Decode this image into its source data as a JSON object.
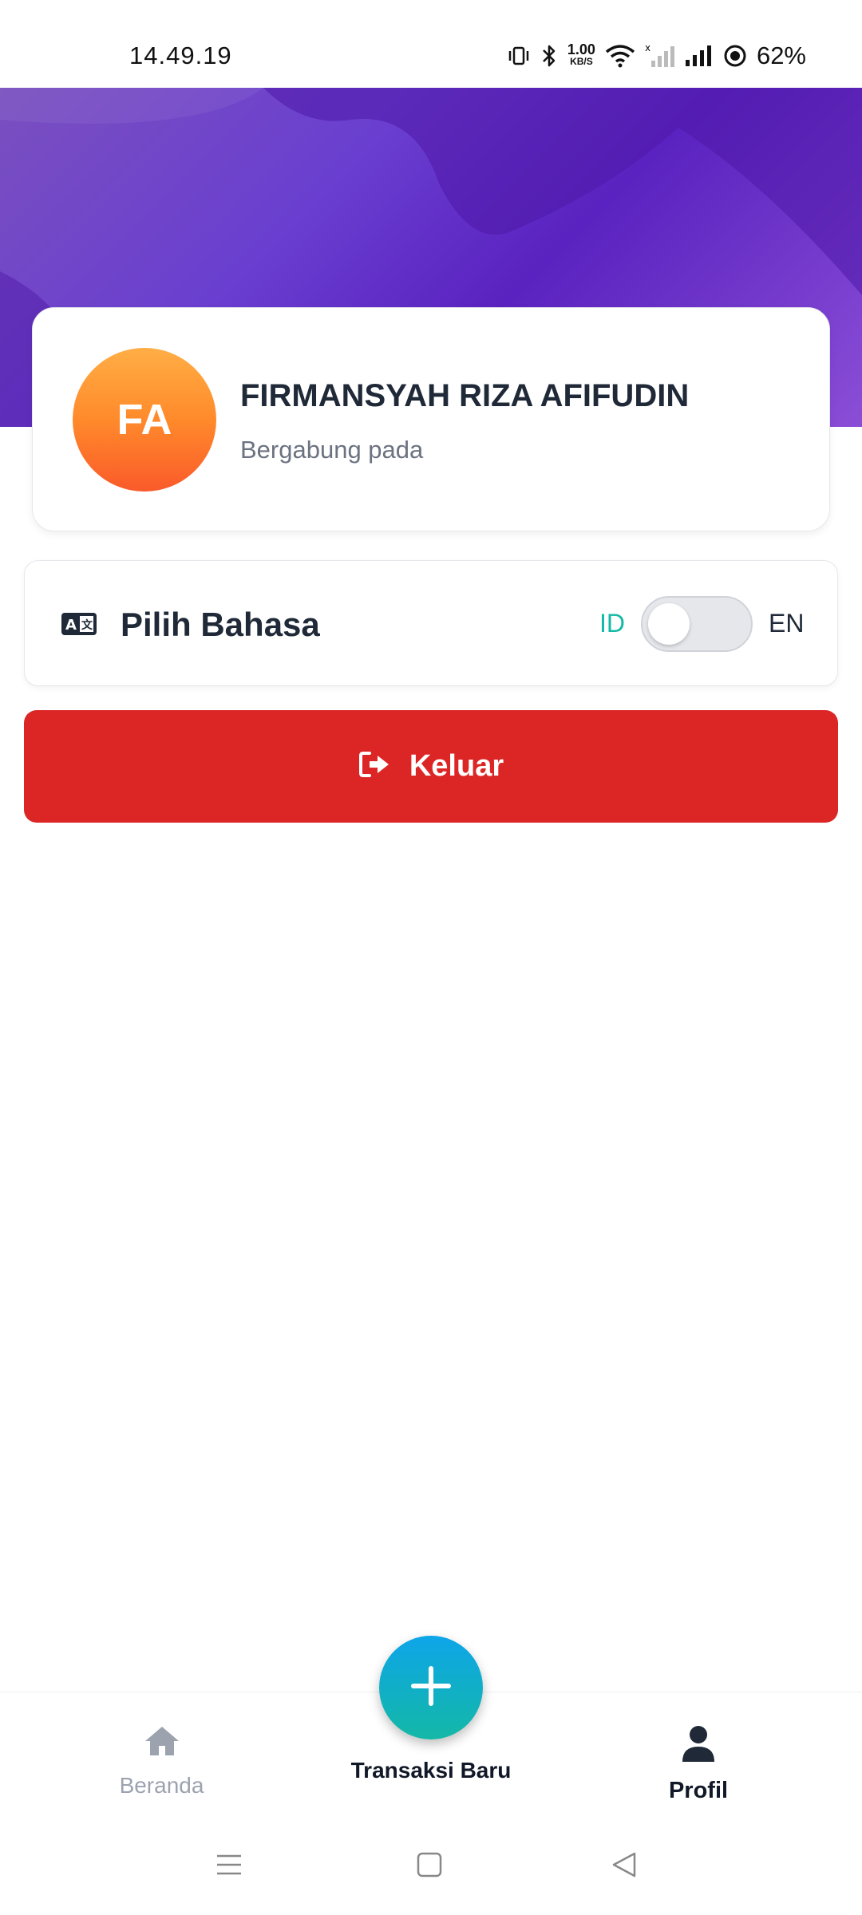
{
  "status_bar": {
    "time": "14.49.19",
    "net_speed_value": "1.00",
    "net_speed_unit": "KB/S",
    "battery": "62%",
    "icons": [
      "vibrate-icon",
      "bluetooth-icon",
      "wifi-icon",
      "signal-off-icon",
      "signal-icon",
      "battery-icon"
    ]
  },
  "profile": {
    "initials": "FA",
    "name": "FIRMANSYAH RIZA AFIFUDIN",
    "joined_label": "Bergabung pada"
  },
  "language": {
    "icon": "translate-icon",
    "label": "Pilih Bahasa",
    "option_left": "ID",
    "option_right": "EN",
    "selected": "ID"
  },
  "logout": {
    "icon": "logout-icon",
    "label": "Keluar"
  },
  "bottom_nav": {
    "home_label": "Beranda",
    "new_transaction_label": "Transaksi Baru",
    "profile_label": "Profil",
    "active": "Profil"
  },
  "colors": {
    "header_gradient": [
      "#7a4fbf",
      "#5a22c0",
      "#8a4ed6"
    ],
    "avatar_gradient": [
      "#ffae45",
      "#fa5a2a"
    ],
    "accent_teal": "#14b8a6",
    "logout_red": "#dc2626",
    "fab_gradient": [
      "#0ea5e9",
      "#14b8a6"
    ]
  }
}
